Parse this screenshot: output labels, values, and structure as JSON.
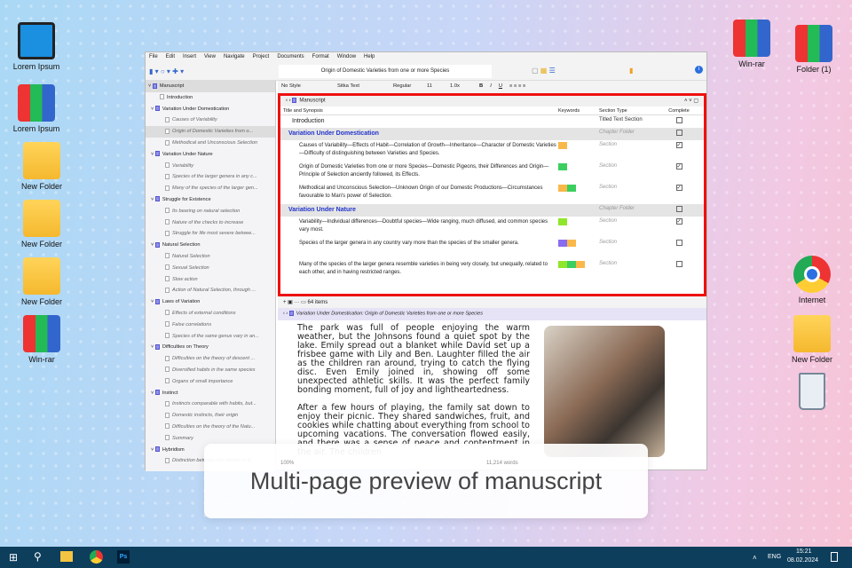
{
  "desktop": {
    "left": [
      "Lorem Ipsum",
      "Lorem Ipsum",
      "New Folder",
      "New Folder",
      "New Folder",
      "Win-rar"
    ],
    "right": [
      "Win-rar",
      "Folder (1)",
      "Internet",
      "New Folder"
    ]
  },
  "menu": [
    "File",
    "Edit",
    "Insert",
    "View",
    "Navigate",
    "Project",
    "Documents",
    "Format",
    "Window",
    "Help"
  ],
  "document_title": "Origin of Domestic Varieties from one or more Species",
  "format_bar": {
    "style": "No Style",
    "font": "Sitka Text",
    "weight": "Regular",
    "size": "11",
    "spacing": "1.0x",
    "bold": "B",
    "italic": "I",
    "underline": "U"
  },
  "binder": [
    {
      "t": "Manuscript",
      "k": "root"
    },
    {
      "t": "Introduction",
      "k": "f"
    },
    {
      "t": "Variation Under Domestication",
      "k": "c"
    },
    {
      "t": "Causes of Variability",
      "k": "d"
    },
    {
      "t": "Origin of Domestic Varieties from o...",
      "k": "d",
      "sel": true
    },
    {
      "t": "Methodical and Unconscious Selection",
      "k": "d"
    },
    {
      "t": "Variation Under Nature",
      "k": "c"
    },
    {
      "t": "Variability",
      "k": "d"
    },
    {
      "t": "Species of the larger genera in any c...",
      "k": "d"
    },
    {
      "t": "Many of the species of the larger gen...",
      "k": "d"
    },
    {
      "t": "Struggle for Existence",
      "k": "c"
    },
    {
      "t": "Its bearing on natural selection",
      "k": "d"
    },
    {
      "t": "Nature of the checks to increase",
      "k": "d"
    },
    {
      "t": "Struggle for life most severe betwee...",
      "k": "d"
    },
    {
      "t": "Natural Selection",
      "k": "c"
    },
    {
      "t": "Natural Selection",
      "k": "d"
    },
    {
      "t": "Sexual Selection",
      "k": "d"
    },
    {
      "t": "Slow action",
      "k": "d"
    },
    {
      "t": "Action of Natural Selection, through ...",
      "k": "d"
    },
    {
      "t": "Laws of Variation",
      "k": "c"
    },
    {
      "t": "Effects of external conditions",
      "k": "d"
    },
    {
      "t": "False correlations",
      "k": "d"
    },
    {
      "t": "Species of the same genus vary in an...",
      "k": "d"
    },
    {
      "t": "Difficulties on Theory",
      "k": "c"
    },
    {
      "t": "Difficulties on the theory of descent ...",
      "k": "d"
    },
    {
      "t": "Diversified habits in the same species",
      "k": "d"
    },
    {
      "t": "Organs of small importance",
      "k": "d"
    },
    {
      "t": "Instinct",
      "k": "c"
    },
    {
      "t": "Instincts comparable with habits, but...",
      "k": "d"
    },
    {
      "t": "Domestic instincts, their origin",
      "k": "d"
    },
    {
      "t": "Difficulties on the theory of the Natu...",
      "k": "d"
    },
    {
      "t": "Summary",
      "k": "d"
    },
    {
      "t": "Hybridism",
      "k": "c"
    },
    {
      "t": "Distinction between the sterility of fir...",
      "k": "d"
    }
  ],
  "outline": {
    "breadcrumb": "Manuscript",
    "columns": [
      "Title and Synopsis",
      "Keywords",
      "Section Type",
      "Complete"
    ],
    "rows": [
      {
        "title": "Introduction",
        "type": "Titled Text Section",
        "complete": false,
        "chapter": false,
        "kw": []
      },
      {
        "title": "Variation Under Domestication",
        "type": "Chapter Folder",
        "complete": false,
        "chapter": true,
        "kw": []
      },
      {
        "title": "Causes of Variability—Effects of Habit—Correlation of Growth—Inheritance—Character of Domestic Varieties—Difficulty of distinguishing between Varieties and Species.",
        "type": "Section",
        "complete": true,
        "kw": [
          "#f9b84a"
        ]
      },
      {
        "title": "Origin of Domestic Varieties from one or more Species—Domestic Pigeons, their Differences and Origin—Principle of Selection anciently followed, its Effects.",
        "type": "Section",
        "complete": true,
        "kw": [
          "#3ccf5f"
        ]
      },
      {
        "title": "Methodical and Unconscious Selection—Unknown Origin of our Domestic Productions—Circumstances favourable to Man's power of Selection.",
        "type": "Section",
        "complete": true,
        "kw": [
          "#f9b84a",
          "#3ccf5f"
        ]
      },
      {
        "title": "Variation Under Nature",
        "type": "Chapter Folder",
        "complete": false,
        "chapter": true,
        "kw": []
      },
      {
        "title": "Variability—Individual differences—Doubtful species—Wide ranging, much diffused, and common species vary most.",
        "type": "Section",
        "complete": true,
        "kw": [
          "#8fe62a"
        ]
      },
      {
        "title": "Species of the larger genera in any country vary more than the species of the smaller genera.",
        "type": "Section",
        "complete": false,
        "kw": [
          "#8a6cf0",
          "#f9b84a"
        ]
      },
      {
        "title": "Many of the species of the larger genera resemble varieties in being very closely, but unequally, related to each other, and in having restricted ranges.",
        "type": "Section",
        "complete": false,
        "kw": [
          "#8fe62a",
          "#3ccf5f",
          "#f9b84a"
        ]
      }
    ]
  },
  "footer": {
    "items": "64 items"
  },
  "editor": {
    "header": "Variation Under Domestication: Origin of Domestic Varieties from one or more Species",
    "p1": "The park was full of people enjoying the warm weather, but the Johnsons found a quiet spot by the lake. Emily spread out a blanket while David set up a frisbee game with Lily and Ben. Laughter filled the air as the children ran around, trying to catch the flying disc. Even Emily joined in, showing off some unexpected athletic skills. It was the perfect family bonding moment, full of joy and lightheartedness.",
    "p2": "After a few hours of playing, the family sat down to enjoy their picnic. They shared sandwiches, fruit, and cookies while chatting about everything from school to upcoming vacations. The conversation flowed easily, and there was a sense of peace and contentment in the air. The children",
    "zoom": "100%",
    "words": "11,214 words"
  },
  "caption": "Multi-page preview of manuscript",
  "taskbar": {
    "lang": "ENG",
    "time": "15:21",
    "date": "08.02.2024",
    "ps": "Ps"
  }
}
